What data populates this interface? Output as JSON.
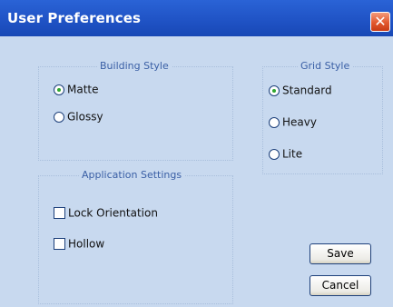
{
  "window": {
    "title": "User Preferences",
    "close_glyph": "✕"
  },
  "building_style": {
    "legend": "Building Style",
    "options": [
      {
        "label": "Matte",
        "selected": true
      },
      {
        "label": "Glossy",
        "selected": false
      }
    ]
  },
  "grid_style": {
    "legend": "Grid Style",
    "options": [
      {
        "label": "Standard",
        "selected": true
      },
      {
        "label": "Heavy",
        "selected": false
      },
      {
        "label": "Lite",
        "selected": false
      }
    ]
  },
  "application_settings": {
    "legend": "Application Settings",
    "checkboxes": [
      {
        "label": "Lock Orientation",
        "checked": false
      },
      {
        "label": "Hollow",
        "checked": false
      }
    ]
  },
  "buttons": {
    "save": "Save",
    "cancel": "Cancel"
  },
  "colors": {
    "title_bar": "#1f52c4",
    "background": "#c8d9ef",
    "close_button": "#e2582d",
    "legend_text": "#3a5fa5"
  }
}
